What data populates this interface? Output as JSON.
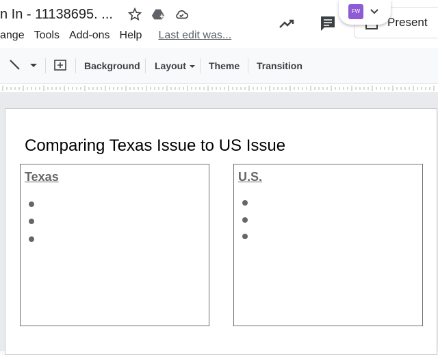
{
  "header": {
    "doc_title": "n In - 11138695. ...",
    "menu": [
      "ange",
      "Tools",
      "Add-ons",
      "Help"
    ],
    "last_edit": "Last edit was..."
  },
  "present_button": {
    "label": "Present"
  },
  "extension": {
    "label": "FW"
  },
  "toolbar": {
    "background": "Background",
    "layout": "Layout",
    "theme": "Theme",
    "transition": "Transition"
  },
  "slide": {
    "title": "Comparing Texas Issue to US Issue",
    "left_box": {
      "heading": "Texas",
      "bullets": [
        "",
        "",
        ""
      ]
    },
    "right_box": {
      "heading": "U.S.",
      "bullets": [
        "",
        "",
        ""
      ]
    }
  },
  "colors": {
    "extension_purple": "#8e5bd6",
    "text": "#202124",
    "muted": "#5f6368"
  }
}
